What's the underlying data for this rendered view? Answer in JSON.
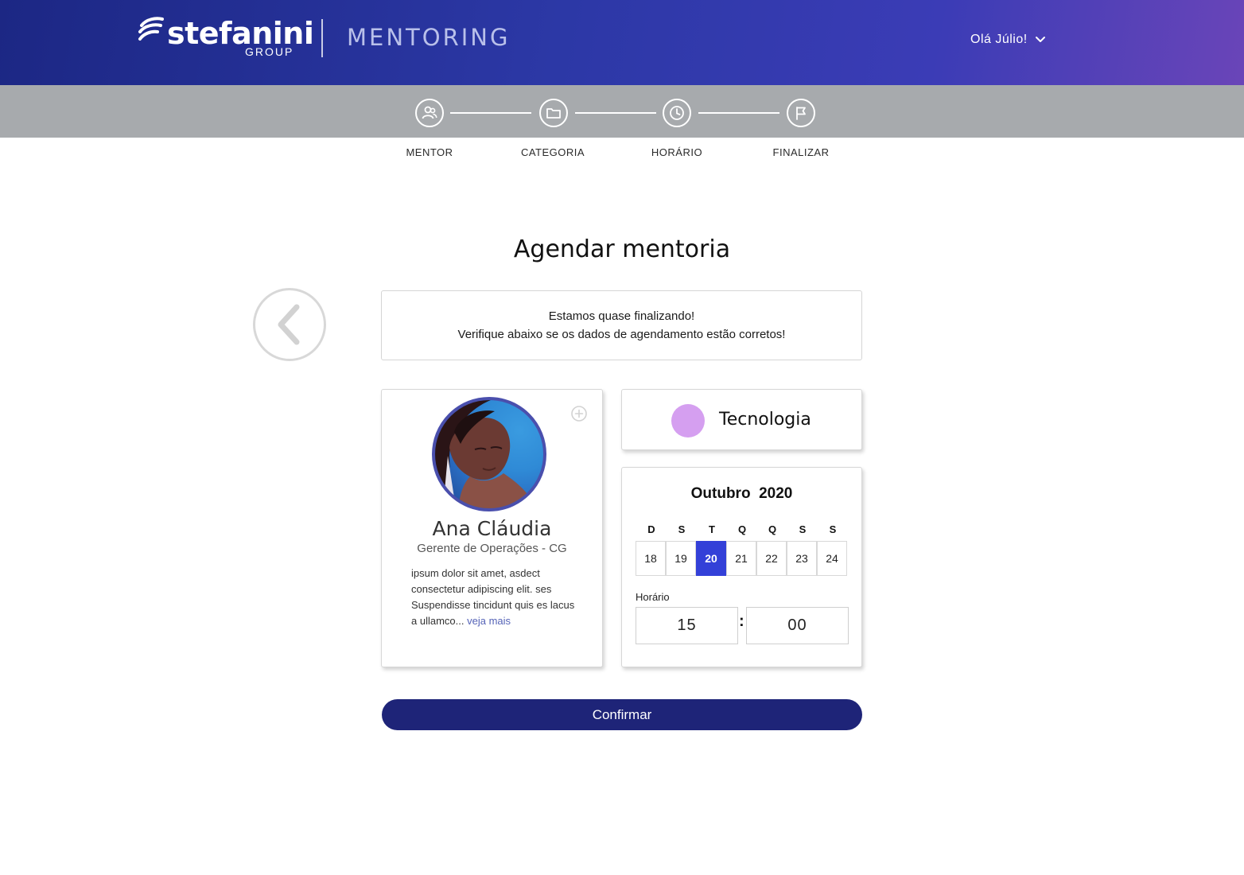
{
  "header": {
    "logo_word": "stefanini",
    "logo_sub": "GROUP",
    "brand_title": "MENTORING",
    "user_greeting": "Olá Júlio!",
    "user_menu_icon": "chevron-down-icon"
  },
  "stepper": {
    "steps": [
      {
        "label": "MENTOR",
        "icon": "people-icon"
      },
      {
        "label": "CATEGORIA",
        "icon": "folder-icon"
      },
      {
        "label": "HORÁRIO",
        "icon": "clock-icon"
      },
      {
        "label": "FINALIZAR",
        "icon": "flag-icon"
      }
    ]
  },
  "page": {
    "title": "Agendar mentoria",
    "back_icon": "chevron-left-icon",
    "info_line1": "Estamos quase finalizando!",
    "info_line2": "Verifique abaixo se os dados de agendamento estão corretos!"
  },
  "mentor": {
    "name": "Ana Cláudia",
    "role": "Gerente de Operações - CG",
    "bio": " ipsum dolor sit amet, asdect consectetur adipiscing elit. ses Suspendisse tincidunt quis es lacus a ullamco...",
    "see_more": "veja mais",
    "add_icon": "plus-circle-icon"
  },
  "category": {
    "name": "Tecnologia",
    "color": "#d59ff0"
  },
  "calendar": {
    "month_year": "Outubro  2020",
    "weekdays": [
      "D",
      "S",
      "T",
      "Q",
      "Q",
      "S",
      "S"
    ],
    "days": [
      "18",
      "19",
      "20",
      "21",
      "22",
      "23",
      "24"
    ],
    "selected_day": "20",
    "time_label": "Horário",
    "hour": "15",
    "separator": ":",
    "minute": "00"
  },
  "actions": {
    "confirm_label": "Confirmar"
  },
  "colors": {
    "header_start": "#1c2784",
    "header_end": "#6a45b8",
    "stepper_bg": "#a7aaad",
    "selected_day": "#3340d8",
    "confirm_button": "#1e2478",
    "link": "#5563b7"
  }
}
